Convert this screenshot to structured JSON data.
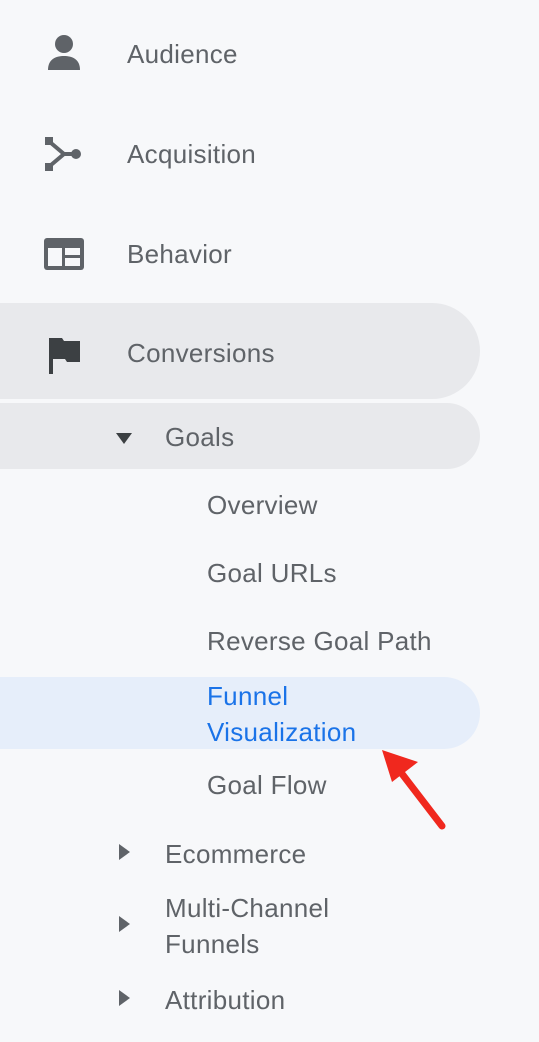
{
  "top_items": [
    {
      "label": "Audience",
      "icon": "person-icon"
    },
    {
      "label": "Acquisition",
      "icon": "acquisition-icon"
    },
    {
      "label": "Behavior",
      "icon": "behavior-icon"
    },
    {
      "label": "Conversions",
      "icon": "flag-icon"
    }
  ],
  "goals": {
    "label": "Goals",
    "expanded": true,
    "children": [
      {
        "label": "Overview"
      },
      {
        "label": "Goal URLs"
      },
      {
        "label": "Reverse Goal Path"
      },
      {
        "label": "Funnel Visualization",
        "active": true
      },
      {
        "label": "Goal Flow"
      }
    ]
  },
  "collapsed_sections": [
    {
      "label": "Ecommerce"
    },
    {
      "label": "Multi-Channel Funnels"
    },
    {
      "label": "Attribution"
    }
  ],
  "colors": {
    "active_text": "#1a73e8",
    "active_bg": "#e6eefa",
    "hover_bg": "#e8e9ec",
    "text": "#5f6368",
    "annotation_arrow": "#f0281e"
  }
}
